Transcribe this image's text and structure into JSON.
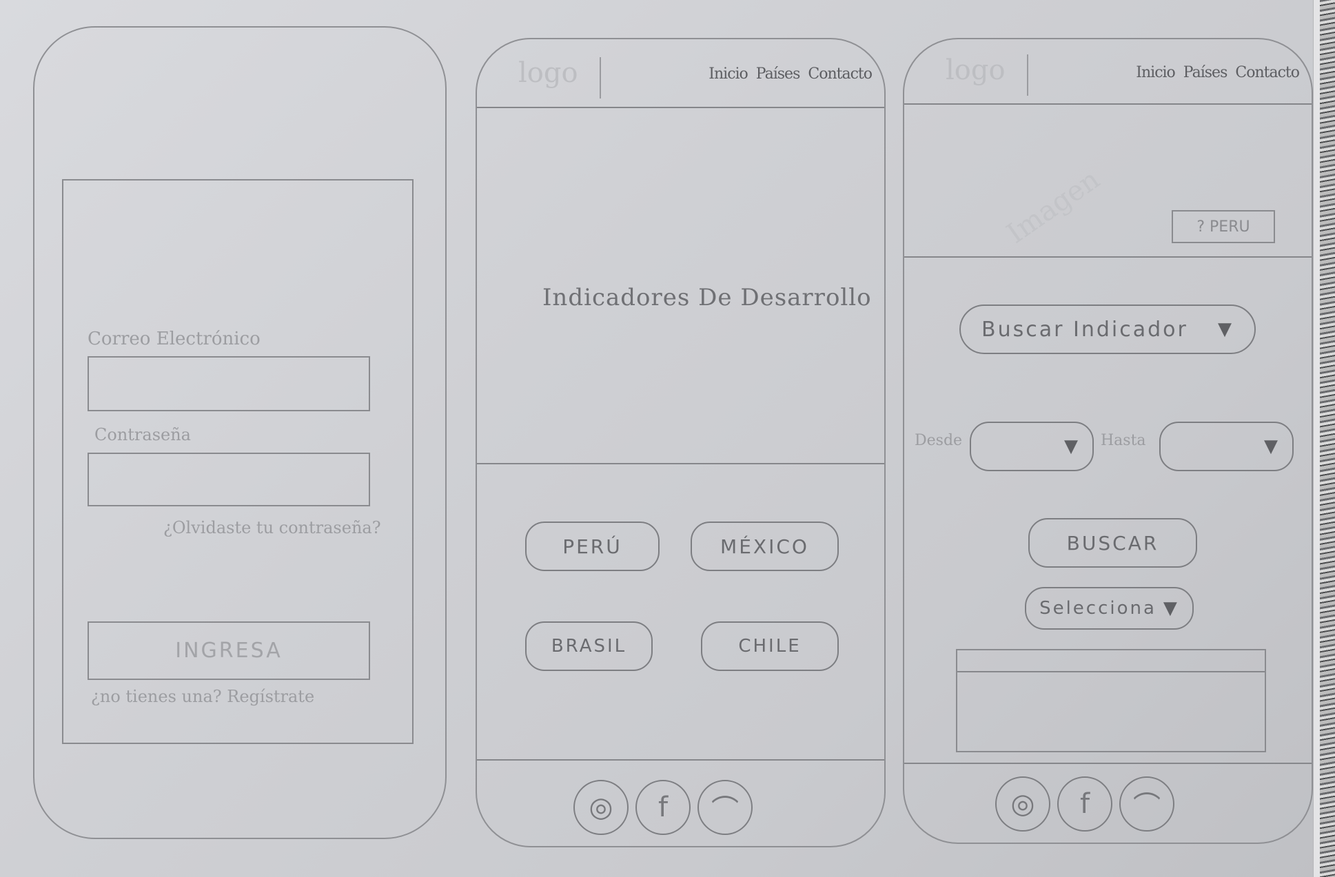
{
  "login_screen": {
    "email_label": "Correo Electrónico",
    "password_label": "Contraseña",
    "forgot_link": "¿Olvidaste tu contraseña?",
    "submit_button": "INGRESA",
    "register_text": "¿no tienes una? Regístrate"
  },
  "home_screen": {
    "logo": "logo",
    "nav": [
      "Inicio",
      "Países",
      "Contacto"
    ],
    "hero_title": "Indicadores De Desarrollo",
    "countries": [
      "PERÚ",
      "MÉXICO",
      "BRASIL",
      "CHILE"
    ],
    "social_icons": [
      "instagram-icon",
      "facebook-icon",
      "twitter-icon"
    ]
  },
  "detail_screen": {
    "logo": "logo",
    "nav": [
      "Inicio",
      "Países",
      "Contacto"
    ],
    "image_placeholder": "Imagen",
    "country_badge": "? PERU",
    "search_indicator": "Buscar Indicador",
    "from_label": "Desde",
    "to_label": "Hasta",
    "search_button": "BUSCAR",
    "select_dropdown": "Selecciona",
    "dropdown_arrow": "▼",
    "social_icons": [
      "instagram-icon",
      "facebook-icon",
      "twitter-icon"
    ]
  }
}
